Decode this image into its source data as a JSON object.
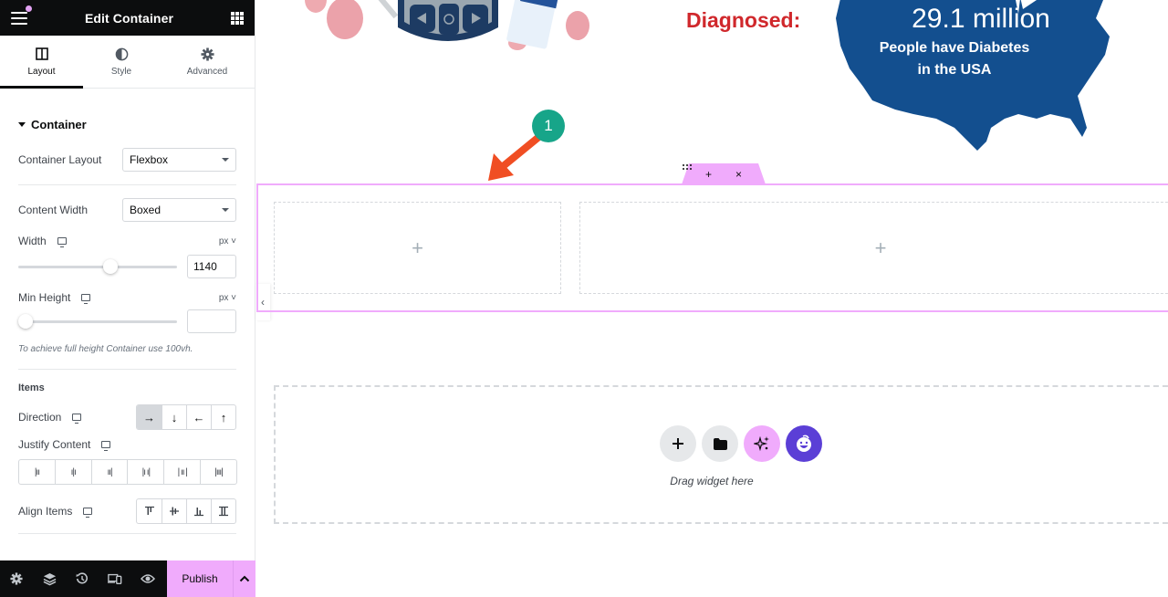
{
  "panel": {
    "title": "Edit Container",
    "tabs": [
      {
        "label": "Layout",
        "icon": "columns-icon",
        "active": true
      },
      {
        "label": "Style",
        "icon": "contrast-icon",
        "active": false
      },
      {
        "label": "Advanced",
        "icon": "gear-icon",
        "active": false
      }
    ],
    "section_title": "Container",
    "container_layout": {
      "label": "Container Layout",
      "value": "Flexbox"
    },
    "content_width": {
      "label": "Content Width",
      "value": "Boxed"
    },
    "width": {
      "label": "Width",
      "unit": "px",
      "value": "1140",
      "slider_fraction": 0.58
    },
    "min_height": {
      "label": "Min Height",
      "unit": "px",
      "value": "",
      "slider_fraction": 0.0
    },
    "hint": "To achieve full height Container use 100vh.",
    "items_title": "Items",
    "direction": {
      "label": "Direction",
      "options": [
        "→",
        "↓",
        "←",
        "↑"
      ],
      "selected": 0
    },
    "justify_content": {
      "label": "Justify Content",
      "options": [
        "start",
        "center",
        "end",
        "space-between",
        "space-around",
        "space-evenly"
      ]
    },
    "align_items": {
      "label": "Align Items",
      "options": [
        "start",
        "center",
        "end",
        "stretch"
      ]
    }
  },
  "footer": {
    "icons": [
      "settings-icon",
      "layers-icon",
      "history-icon",
      "responsive-icon",
      "preview-icon"
    ],
    "publish_label": "Publish"
  },
  "canvas": {
    "diagnosed_label": "Diagnosed:",
    "map_big": "29.1 million",
    "map_sub_line1": "People have Diabetes",
    "map_sub_line2": "in the USA",
    "annotation_number": "1",
    "container_actions": [
      "+",
      ":::",
      "×"
    ],
    "drop_zone_text": "Drag widget here"
  },
  "colors": {
    "accent_pink": "#f0abfc",
    "annotation_green": "#17a589",
    "arrow_red": "#f04e23",
    "map_blue": "#134f8f",
    "diagnosed_red": "#d0282c",
    "ai_purple": "#5b3fd6"
  }
}
